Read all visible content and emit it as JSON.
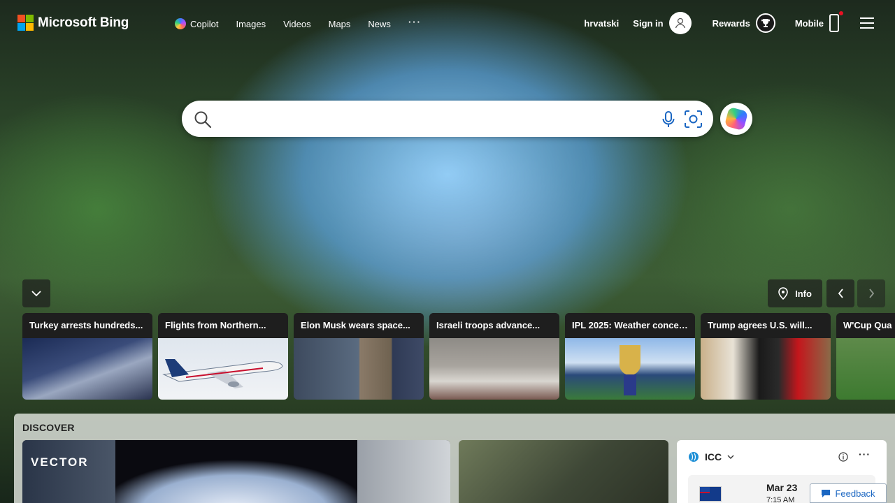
{
  "brand": {
    "name": "Microsoft Bing"
  },
  "nav": {
    "copilot": "Copilot",
    "images": "Images",
    "videos": "Videos",
    "maps": "Maps",
    "news": "News",
    "more": "···"
  },
  "header_right": {
    "language": "hrvatski",
    "sign_in": "Sign in",
    "rewards": "Rewards",
    "mobile": "Mobile"
  },
  "search": {
    "placeholder": "",
    "value": ""
  },
  "controls": {
    "info": "Info"
  },
  "news": [
    {
      "title": "Turkey arrests hundreds..."
    },
    {
      "title": "Flights from Northern..."
    },
    {
      "title": "Elon Musk wears space..."
    },
    {
      "title": "Israeli troops advance..."
    },
    {
      "title": "IPL 2025: Weather concer..."
    },
    {
      "title": "Trump agrees U.S. will..."
    },
    {
      "title": "W'Cup Qua"
    }
  ],
  "discover": {
    "title": "DISCOVER",
    "card1_logo": "VECTOR",
    "widget": {
      "name": "ICC",
      "date": "Mar 23",
      "time": "7:15 AM"
    }
  },
  "feedback": "Feedback",
  "icons": [
    "search-icon",
    "mic-icon",
    "visual-search-icon",
    "copilot-icon",
    "user-icon",
    "trophy-icon",
    "phone-icon",
    "hamburger-icon",
    "chevron-down-icon",
    "location-icon",
    "chevron-left-icon",
    "chevron-right-icon",
    "info-icon",
    "more-icon",
    "feedback-icon"
  ]
}
